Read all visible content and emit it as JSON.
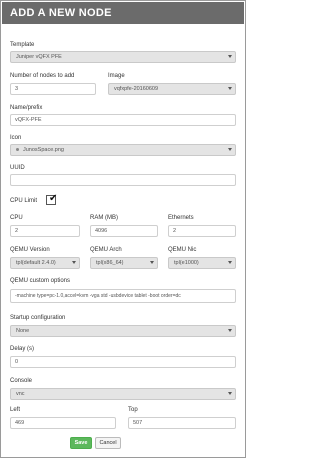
{
  "dialog": {
    "title": "ADD A NEW NODE"
  },
  "template": {
    "label": "Template",
    "value": "Juniper vQFX PFE"
  },
  "nodes": {
    "label": "Number of nodes to add",
    "value": "3"
  },
  "image": {
    "label": "Image",
    "value": "vqfxpfe-20160609"
  },
  "name": {
    "label": "Name/prefix",
    "value": "vQFX-PFE"
  },
  "icon": {
    "label": "Icon",
    "value": "JunosSpace.png"
  },
  "uuid": {
    "label": "UUID",
    "value": ""
  },
  "cpu_limit": {
    "label": "CPU Limit",
    "checked": true,
    "mark": "✔"
  },
  "cpu": {
    "label": "CPU",
    "value": "2"
  },
  "ram": {
    "label": "RAM (MB)",
    "value": "4096"
  },
  "ethernets": {
    "label": "Ethernets",
    "value": "2"
  },
  "qemu_version": {
    "label": "QEMU Version",
    "value": "tpl(default 2.4.0)"
  },
  "qemu_arch": {
    "label": "QEMU Arch",
    "value": "tpl(x86_64)"
  },
  "qemu_nic": {
    "label": "QEMU Nic",
    "value": "tpl(e1000)"
  },
  "qemu_options": {
    "label": "QEMU custom options",
    "value": "-machine type=pc-1.0,accel=kvm -vga std -usbdevice tablet -boot order=dc"
  },
  "startup": {
    "label": "Startup configuration",
    "value": "None"
  },
  "delay": {
    "label": "Delay (s)",
    "value": "0"
  },
  "console": {
    "label": "Console",
    "value": "vnc"
  },
  "left": {
    "label": "Left",
    "value": "469"
  },
  "top": {
    "label": "Top",
    "value": "507"
  },
  "buttons": {
    "save": "Save",
    "cancel": "Cancel"
  },
  "colors": {
    "header": "#6b6b6b",
    "save": "#5cb85c"
  }
}
